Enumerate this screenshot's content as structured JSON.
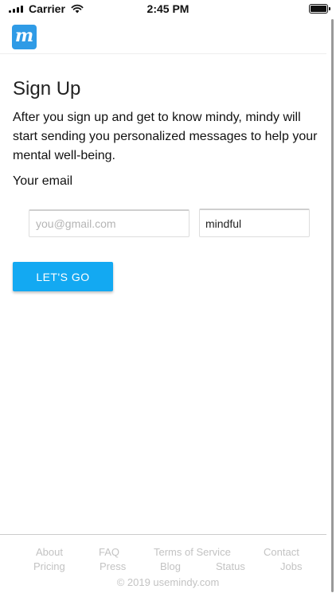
{
  "status_bar": {
    "carrier": "Carrier",
    "time": "2:45 PM",
    "battery_level": 1.0
  },
  "header": {
    "logo_letter": "m",
    "logo_color": "#2f9be6"
  },
  "main": {
    "title": "Sign Up",
    "intro": "After you sign up and get to know mindy, mindy will start sending you personalized messages to help your mental well-being.",
    "email_label": "Your email",
    "email_placeholder": "you@gmail.com",
    "email_value": "",
    "name_value": "mindful",
    "submit_label": "LET'S GO",
    "accent_color": "#13a9f2"
  },
  "footer": {
    "links_row1": [
      "About",
      "FAQ",
      "Terms of Service",
      "Contact"
    ],
    "links_row2": [
      "Pricing",
      "Press",
      "Blog",
      "Status",
      "Jobs"
    ],
    "copyright": "© 2019 usemindy.com"
  }
}
